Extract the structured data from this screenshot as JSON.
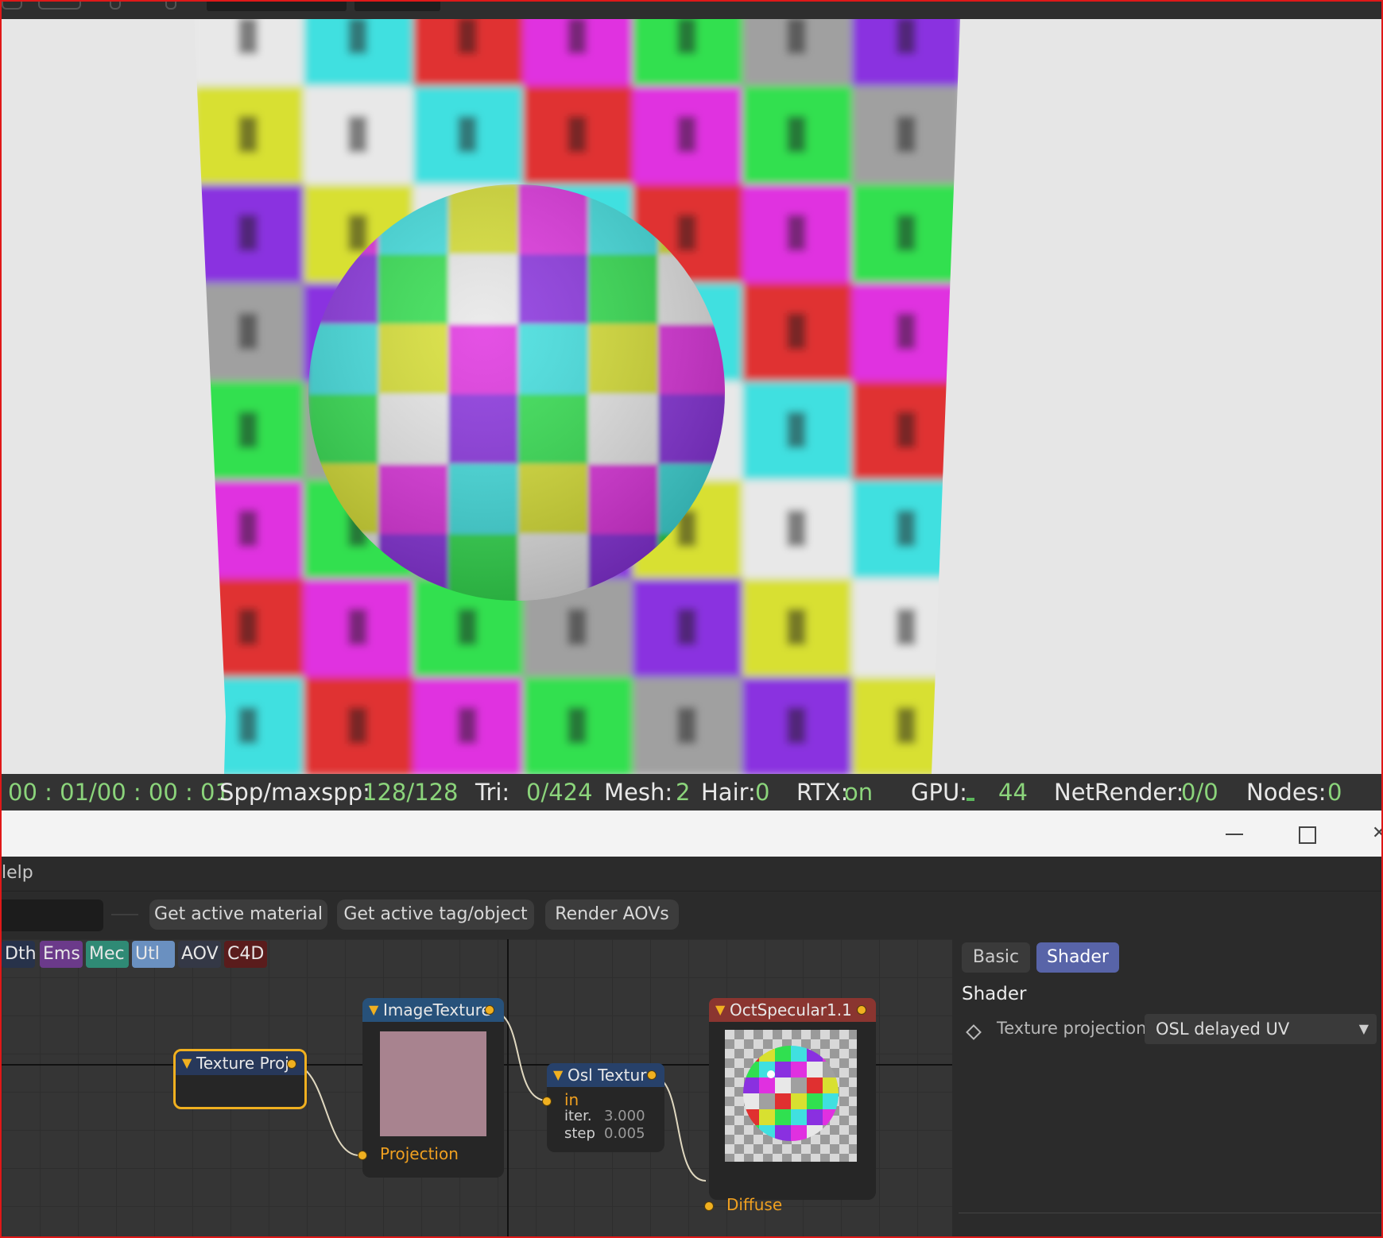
{
  "status": {
    "time": "00 : 01/00 : 00 : 01",
    "spp_label": "Spp/maxspp:",
    "spp_value": "128/128",
    "tri_label": "Tri:",
    "tri_value": "0/424",
    "mesh_label": "Mesh:",
    "mesh_value": "2",
    "hair_label": "Hair:",
    "hair_value": "0",
    "rtx_label": "RTX:",
    "rtx_value": "on",
    "gpu_label": "GPU:",
    "gpu_value": "44",
    "net_label": "NetRender:",
    "net_value": "0/0",
    "nodes_label": "Nodes:",
    "nodes_value": "0"
  },
  "menu": {
    "help": "lelp"
  },
  "toolbar": {
    "get_material": "Get active material",
    "get_tag": "Get active tag/object",
    "render_aovs": "Render AOVs"
  },
  "categories": [
    {
      "label": "Dth",
      "color": "#27324a"
    },
    {
      "label": "Ems",
      "color": "#6b3a8a"
    },
    {
      "label": "Mec",
      "color": "#2f8a75"
    },
    {
      "label": "Utl",
      "color": "#6a90c0"
    },
    {
      "label": "AOV",
      "color": "#343846"
    },
    {
      "label": "C4D",
      "color": "#5a1c1c"
    }
  ],
  "nodes": {
    "texture_proj": {
      "title": "Texture Proj",
      "head_color": "#27385a"
    },
    "image_texture": {
      "title": "ImageTexture",
      "port": "Projection",
      "head_color": "#27517a",
      "swatch": "#a8838f"
    },
    "osl_texture": {
      "title": "Osl Textur",
      "port_in": "in",
      "iter_label": "iter.",
      "iter_value": "3.000",
      "step_label": "step",
      "step_value": "0.005",
      "head_color": "#27416a"
    },
    "oct_specular": {
      "title": "OctSpecular1.1",
      "port": "Diffuse",
      "head_color": "#8a3530"
    }
  },
  "side_panel": {
    "tab_basic": "Basic",
    "tab_shader": "Shader",
    "section": "Shader",
    "param_label": "Texture projection",
    "param_value": "OSL delayed UV"
  },
  "colors": {
    "accent": "#f0b020",
    "status_green": "#8bd47b",
    "active_tab": "#5864a8"
  }
}
